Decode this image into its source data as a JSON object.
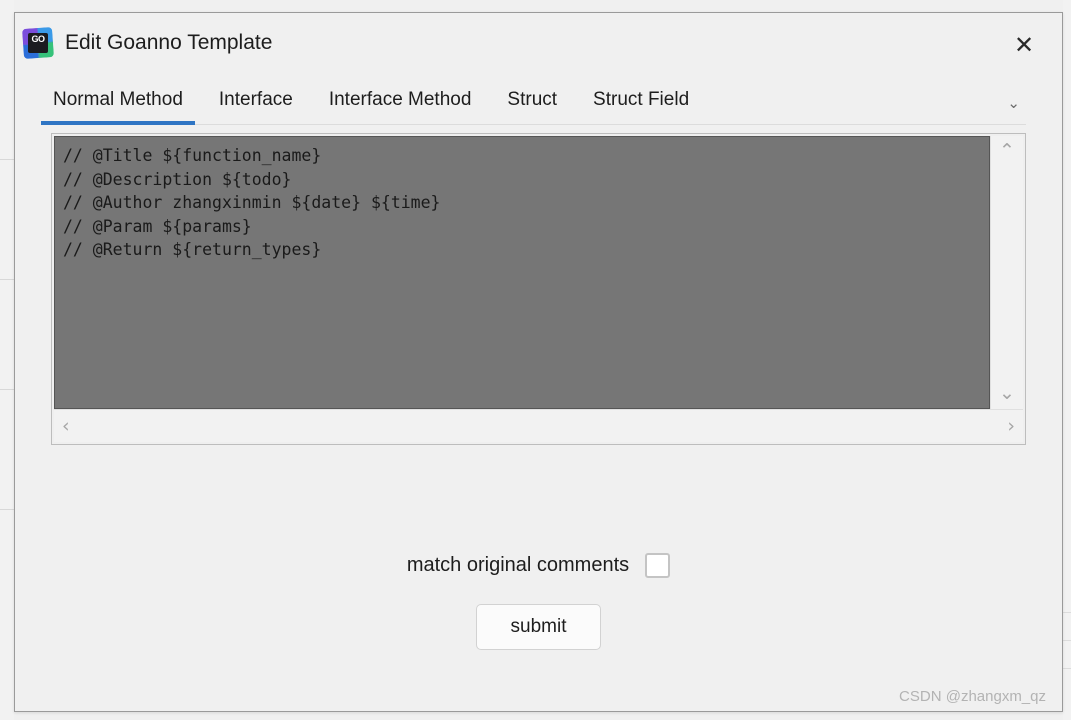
{
  "window": {
    "title": "Edit Goanno Template",
    "icon_name": "goland-logo-icon",
    "icon_text": "GO",
    "close_label": "✕",
    "accent_color": "#2f75c4",
    "editor_background": "#767676"
  },
  "tabs": {
    "items": [
      {
        "label": "Normal Method",
        "active": true
      },
      {
        "label": "Interface",
        "active": false
      },
      {
        "label": "Interface Method",
        "active": false
      },
      {
        "label": "Struct",
        "active": false
      },
      {
        "label": "Struct Field",
        "active": false
      }
    ],
    "overflow_icon": "⌄"
  },
  "editor": {
    "content": "// @Title ${function_name}\n// @Description ${todo}\n// @Author zhangxinmin ${date} ${time}\n// @Param ${params}\n// @Return ${return_types}",
    "scroll_up_icon": "⌃",
    "scroll_down_icon": "⌄",
    "scroll_left_icon": "‹",
    "scroll_right_icon": "›"
  },
  "footer": {
    "checkbox_label": "match original comments",
    "checkbox_checked": false,
    "submit_label": "submit"
  },
  "watermark": {
    "text": "CSDN @zhangxm_qz"
  }
}
